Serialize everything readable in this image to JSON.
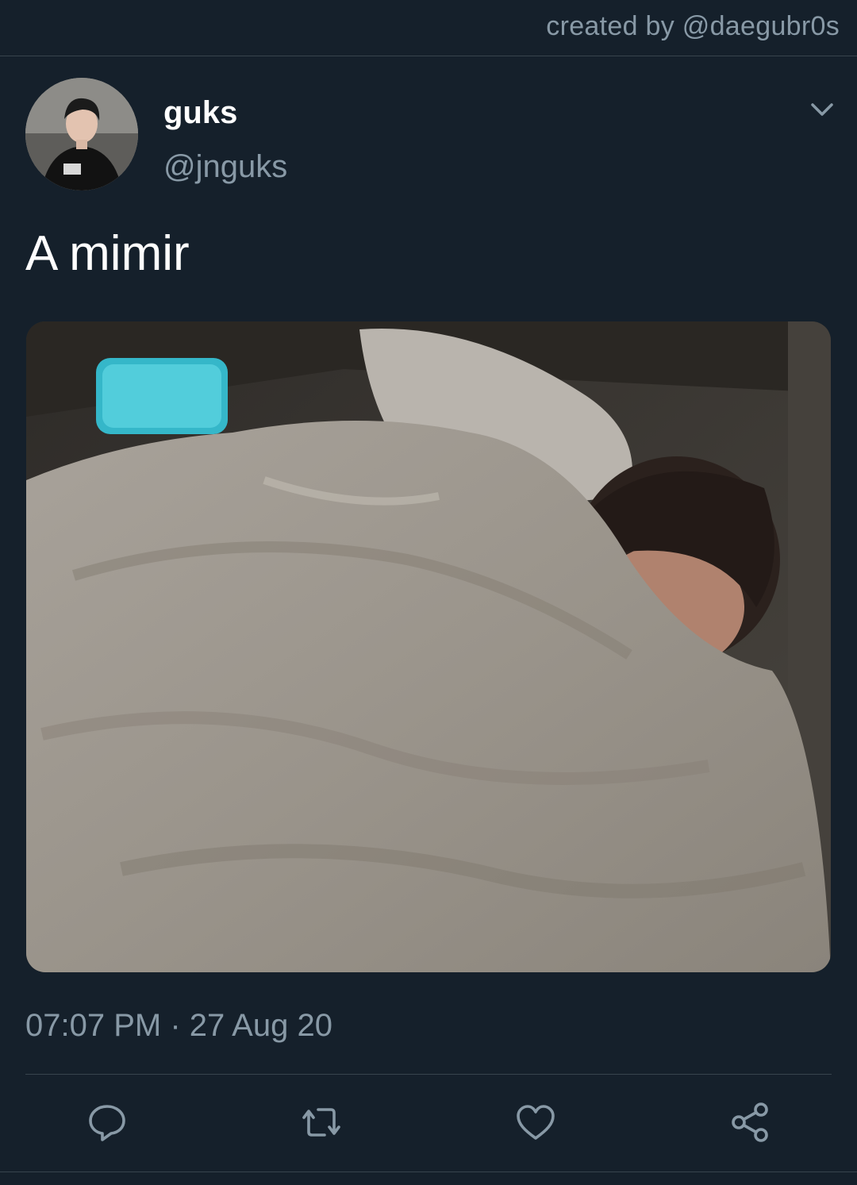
{
  "header": {
    "credit": "created by @daegubr0s"
  },
  "tweet": {
    "display_name": "guks",
    "handle": "@jnguks",
    "text": "A mimir",
    "timestamp": "07:07 PM · 27 Aug 20",
    "media_description": "person sleeping under a grey duvet"
  },
  "icons": {
    "caret": "chevron-down-icon",
    "reply": "reply-icon",
    "retweet": "retweet-icon",
    "like": "heart-icon",
    "share": "share-icon"
  },
  "colors": {
    "background": "#15202b",
    "secondary_text": "#8899a6",
    "divider": "#38444d",
    "primary_text": "#ffffff"
  }
}
